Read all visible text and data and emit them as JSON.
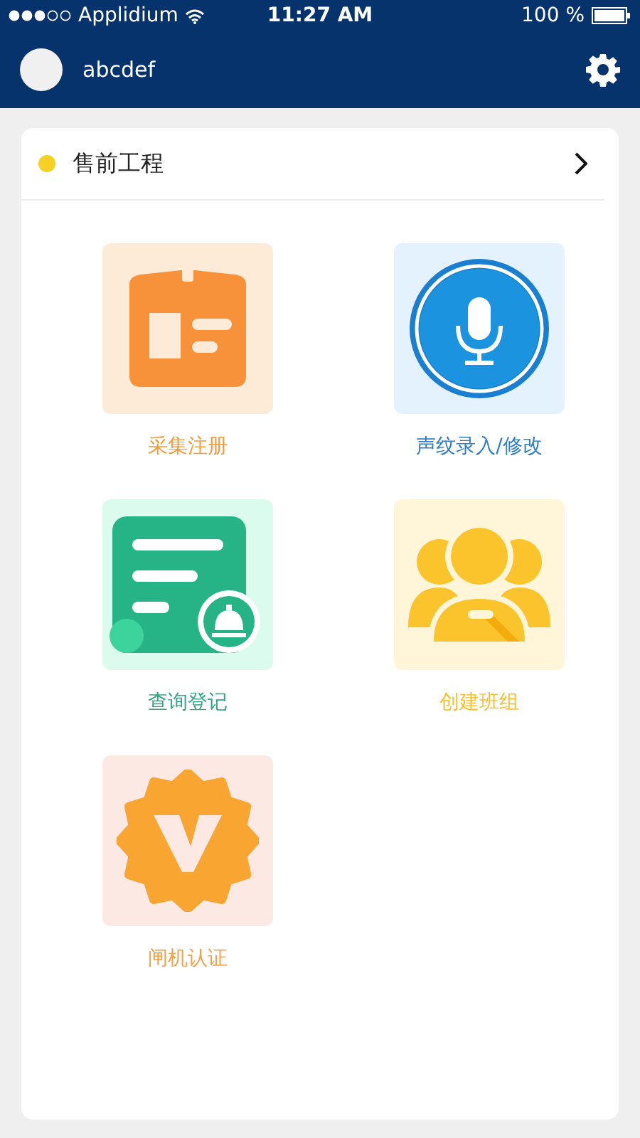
{
  "status_bar": {
    "carrier": "Applidium",
    "time": "11:27 AM",
    "battery": "100 %"
  },
  "header": {
    "username": "abcdef"
  },
  "section": {
    "title": "售前工程"
  },
  "tiles": [
    {
      "kind": "badge",
      "label": "采集注册"
    },
    {
      "kind": "mic",
      "label": "声纹录入/修改"
    },
    {
      "kind": "form",
      "label": "查询登记"
    },
    {
      "kind": "team",
      "label": "创建班组"
    },
    {
      "kind": "verify",
      "label": "闸机认证"
    }
  ]
}
